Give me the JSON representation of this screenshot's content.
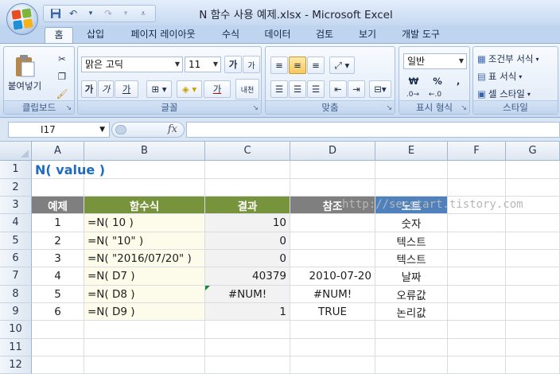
{
  "window": {
    "title": "N 함수 사용 예제.xlsx - Microsoft Excel",
    "qat": {
      "save_icon": "save-icon",
      "undo_icon": "undo-icon",
      "redo_icon": "redo-icon",
      "customize_icon": "chevron-down-icon"
    }
  },
  "tabs": [
    "홈",
    "삽입",
    "페이지 레이아웃",
    "수식",
    "데이터",
    "검토",
    "보기",
    "개발 도구"
  ],
  "ribbon": {
    "clipboard": {
      "label": "클립보드",
      "paste": "붙여넣기"
    },
    "font": {
      "label": "글꼴",
      "font_name": "맑은 고딕",
      "font_size": "11",
      "bold": "가",
      "italic": "가",
      "underline": "가",
      "grow": "가",
      "shrink": "가",
      "fill": "가",
      "phonetic": "내천"
    },
    "alignment": {
      "label": "맞춤"
    },
    "number": {
      "label": "표시 형식",
      "format": "일반",
      "currency": "₩",
      "percent": "%",
      "comma": ","
    },
    "styles": {
      "label": "스타일",
      "conditional": "조건부 서식",
      "table": "표 서식",
      "cell": "셀 스타일"
    }
  },
  "formula_bar": {
    "name_box": "I17",
    "fx": "fx",
    "formula": ""
  },
  "columns": [
    "A",
    "B",
    "C",
    "D",
    "E",
    "F",
    "G"
  ],
  "rows": [
    "1",
    "2",
    "3",
    "4",
    "5",
    "6",
    "7",
    "8",
    "9",
    "10",
    "11",
    "12"
  ],
  "sheet": {
    "title": "N( value )",
    "headers": [
      "예제",
      "함수식",
      "결과",
      "참조",
      "노트"
    ],
    "data": [
      [
        "1",
        "=N( 10 )",
        "10",
        "",
        "숫자"
      ],
      [
        "2",
        "=N( \"10\" )",
        "0",
        "",
        "텍스트"
      ],
      [
        "3",
        "=N( \"2016/07/20\" )",
        "0",
        "",
        "텍스트"
      ],
      [
        "4",
        "=N( D7 )",
        "40379",
        "2010-07-20",
        "날짜"
      ],
      [
        "5",
        "=N( D8 )",
        "#NUM!",
        "#NUM!",
        "오류값"
      ],
      [
        "6",
        "=N( D9 )",
        "1",
        "TRUE",
        "논리값"
      ]
    ]
  },
  "watermark": "http://secstart.tistory.com",
  "colors": {
    "header_green": "#77933c",
    "header_gray": "#7f7f7f",
    "header_blue": "#4f81bd",
    "formula_fill": "#fdfbe9",
    "result_fill": "#f2f2f2",
    "title_blue": "#1f6bc1"
  }
}
